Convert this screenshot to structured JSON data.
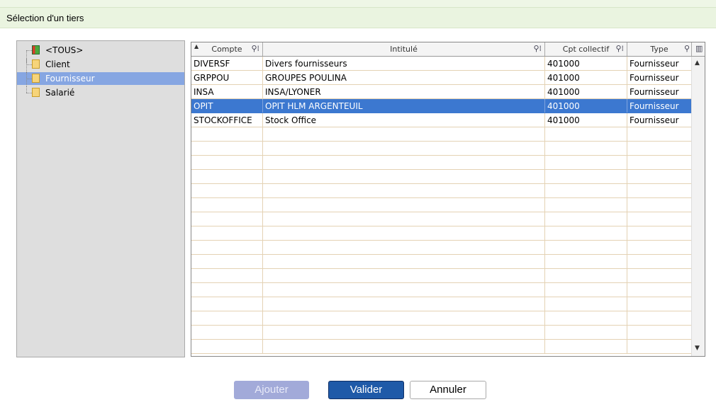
{
  "dialog": {
    "title": "Sélection d'un tiers"
  },
  "tree": {
    "items": [
      {
        "label": "<TOUS>",
        "icon": "all-categories-icon",
        "selected": false
      },
      {
        "label": "Client",
        "icon": "folder-icon",
        "selected": false
      },
      {
        "label": "Fournisseur",
        "icon": "folder-icon",
        "selected": true
      },
      {
        "label": "Salarié",
        "icon": "folder-icon",
        "selected": false
      }
    ]
  },
  "table": {
    "columns": [
      {
        "label": "Compte",
        "sort": "ascending"
      },
      {
        "label": "Intitulé"
      },
      {
        "label": "Cpt collectif"
      },
      {
        "label": "Type"
      }
    ],
    "rows": [
      {
        "compte": "DIVERSF",
        "intitule": "Divers fournisseurs",
        "cpt": "401000",
        "type": "Fournisseur",
        "selected": false
      },
      {
        "compte": "GRPPOU",
        "intitule": "GROUPES POULINA",
        "cpt": "401000",
        "type": "Fournisseur",
        "selected": false
      },
      {
        "compte": "INSA",
        "intitule": "INSA/LYONER",
        "cpt": "401000",
        "type": "Fournisseur",
        "selected": false
      },
      {
        "compte": "OPIT",
        "intitule": "OPIT HLM ARGENTEUIL",
        "cpt": "401000",
        "type": "Fournisseur",
        "selected": true
      },
      {
        "compte": "STOCKOFFICE",
        "intitule": "Stock Office",
        "cpt": "401000",
        "type": "Fournisseur",
        "selected": false
      }
    ]
  },
  "buttons": {
    "ajouter": "Ajouter",
    "valider": "Valider",
    "annuler": "Annuler"
  },
  "colors": {
    "title_bg": "#eaf4e0",
    "selection": "#3c78d0",
    "tree_selection": "#86a6e2",
    "primary_button": "#1f5aa8",
    "disabled_button": "#a2aad9"
  }
}
